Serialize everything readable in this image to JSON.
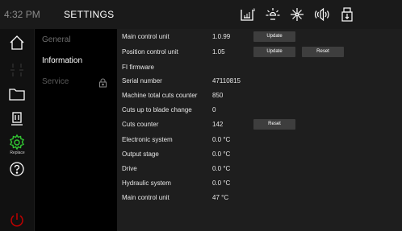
{
  "header": {
    "time": "4:32 PM",
    "title": "SETTINGS"
  },
  "colors": {
    "accent_green": "#32c832",
    "power_red": "#c00000",
    "panel_bg": "#1e1e1e"
  },
  "top_icons": [
    "level-icon",
    "brightness-icon",
    "sparkle-icon",
    "volume-icon",
    "usb-drive-icon"
  ],
  "rail": {
    "replace_label": "Replace"
  },
  "submenu": {
    "items": [
      {
        "label": "General",
        "state": "inactive"
      },
      {
        "label": "Information",
        "state": "active"
      },
      {
        "label": "Service",
        "state": "locked"
      }
    ]
  },
  "info": {
    "rows": [
      {
        "label": "Main control unit",
        "value": "1.0.99",
        "button1": "Update"
      },
      {
        "label": "Position control unit",
        "value": "1.05",
        "button1": "Update",
        "button2": "Reset"
      },
      {
        "label": "FI firmware",
        "value": ""
      },
      {
        "label": "Serial number",
        "value": "47110815"
      },
      {
        "label": "Machine total cuts counter",
        "value": "850"
      },
      {
        "label": "Cuts up to blade change",
        "value": "0"
      },
      {
        "label": "Cuts counter",
        "value": "142",
        "button1": "Reset"
      },
      {
        "label": "Electronic system",
        "value": "0.0 °C"
      },
      {
        "label": "Output stage",
        "value": "0.0 °C"
      },
      {
        "label": "Drive",
        "value": "0.0 °C"
      },
      {
        "label": "Hydraulic system",
        "value": "0.0 °C"
      },
      {
        "label": "Main control unit",
        "value": "47 °C"
      }
    ]
  }
}
